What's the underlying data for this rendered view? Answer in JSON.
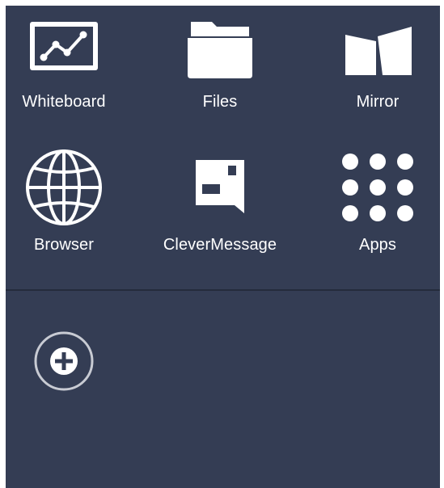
{
  "launcher": {
    "tiles": [
      {
        "label": "Whiteboard",
        "icon": "whiteboard-icon"
      },
      {
        "label": "Files",
        "icon": "folder-icon"
      },
      {
        "label": "Mirror",
        "icon": "mirror-icon"
      },
      {
        "label": "Browser",
        "icon": "globe-icon"
      },
      {
        "label": "CleverMessage",
        "icon": "message-icon"
      },
      {
        "label": "Apps",
        "icon": "apps-grid-icon"
      }
    ],
    "add_button": {
      "icon": "add-circle-icon"
    }
  },
  "colors": {
    "panel_background": "#343d54",
    "divider": "#242b3c",
    "icon": "#ffffff",
    "add_ring": "#c8cbd3"
  }
}
